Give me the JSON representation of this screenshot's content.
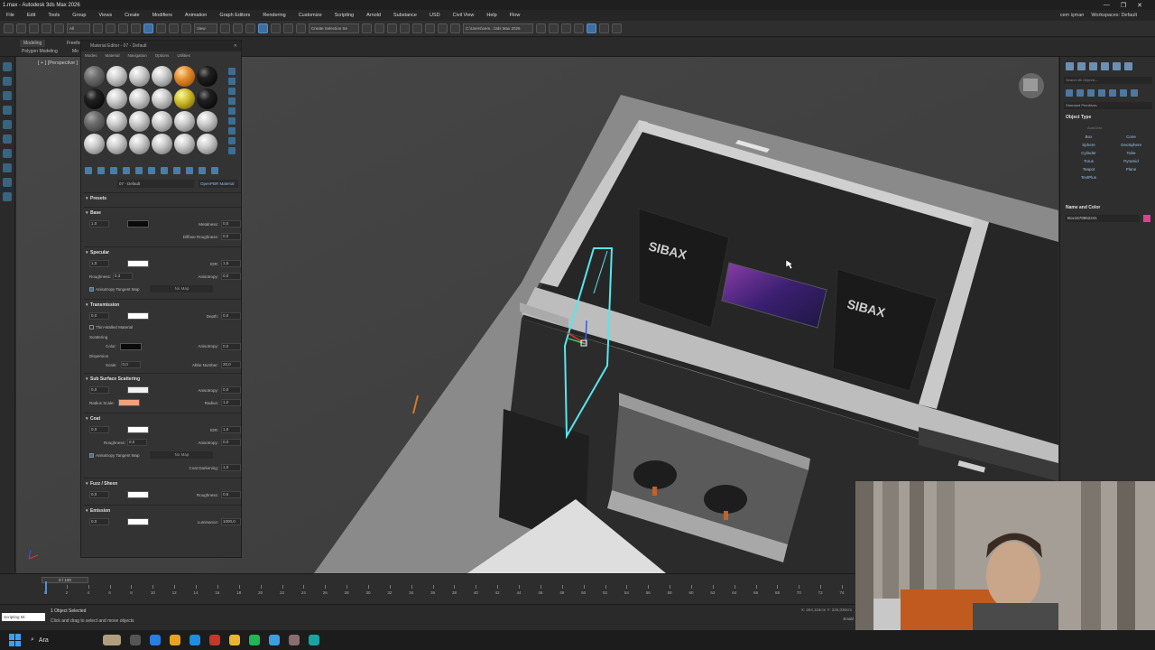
{
  "window": {
    "title": "1.max - Autodesk 3ds Max 2026",
    "controls": [
      "—",
      "❐",
      "✕"
    ]
  },
  "menu": {
    "items": [
      "File",
      "Edit",
      "Tools",
      "Group",
      "Views",
      "Create",
      "Modifiers",
      "Animation",
      "Graph Editors",
      "Rendering",
      "Customize",
      "Scripting",
      "Arnold",
      "Substance",
      "USD",
      "Civil View",
      "Help",
      "Flow"
    ],
    "user": "cem işman",
    "workspace_label": "Workspaces:",
    "workspace_value": "Default"
  },
  "toolbar": {
    "filter_dropdown": "All",
    "view_dropdown": "View",
    "selection_set": "Create Selection Se",
    "path": "C:\\Users\\cem...\\3ds Max 2026"
  },
  "ribbon": {
    "tabs": [
      "Modeling",
      "Freeform",
      "Polygon Modeling",
      "Mo"
    ]
  },
  "viewport": {
    "label": "[ + ] [Perspective ]",
    "sign_text": "SIBAX"
  },
  "material_editor": {
    "title": "Material Editor - 07 - Default",
    "menus": [
      "Modes",
      "Material",
      "Navigation",
      "Options",
      "Utilities"
    ],
    "material_name": "07 - Default",
    "material_type": "OpenPBR Material",
    "presets": "Presets",
    "base": {
      "header": "Base",
      "weight": "1,0",
      "metalness_label": "Metalness:",
      "metalness": "0,0",
      "diffuse_rough_label": "Diffuse Roughness:",
      "diffuse_rough": "0,0"
    },
    "specular": {
      "header": "Specular",
      "weight": "1,0",
      "ior_label": "IOR:",
      "ior": "1,5",
      "roughness_label": "Roughness:",
      "roughness": "0,3",
      "aniso_label": "Anisotropy:",
      "aniso": "0,0",
      "tangent_map": "Anisotropy Tangent Map",
      "no_map": "No Map"
    },
    "transmission": {
      "header": "Transmission",
      "weight": "0,0",
      "depth_label": "Depth:",
      "depth": "0,0",
      "thin_walled": "Thin-Walled Material",
      "scattering": "Scattering",
      "color_label": "Color:",
      "aniso_label": "Anisotropy:",
      "aniso": "0,0",
      "dispersion": "Dispersion",
      "scale_label": "Scale:",
      "scale": "0,0",
      "abbe_label": "Abbe Number:",
      "abbe": "20,0"
    },
    "sss": {
      "header": "Sub Surface Scattering",
      "weight": "0,0",
      "aniso_label": "Anisotropy:",
      "aniso": "0,0",
      "radius_scale_label": "Radius Scale:",
      "radius_label": "Radius:",
      "radius": "1,0"
    },
    "coat": {
      "header": "Coat",
      "weight": "0,0",
      "ior_label": "IOR:",
      "ior": "1,6",
      "roughness_label": "Roughness:",
      "roughness": "0,0",
      "aniso_label": "Anisotropy:",
      "aniso": "0,0",
      "tangent_map": "Anisotropy Tangent Map",
      "no_map": "No Map",
      "darkening_label": "Coat Darkening:",
      "darkening": "1,0"
    },
    "fuzz": {
      "header": "Fuzz / Sheen",
      "weight": "0,0",
      "roughness_label": "Roughness:",
      "roughness": "0,5"
    },
    "emission": {
      "header": "Emission",
      "weight": "0,0",
      "luminance_label": "Luminance:",
      "luminance": "1000,0"
    },
    "colors": {
      "black": "#0a0a0a",
      "white": "#ffffff",
      "light": "#f2f2f2",
      "radius_scale": "#f4a07a"
    }
  },
  "command_panel": {
    "search": "Search All Objects...",
    "category": "Standard Primitives",
    "object_type_header": "Object Type",
    "autogrid": "AutoGrid",
    "objects": [
      "Box",
      "Cone",
      "Sphere",
      "GeoSphere",
      "Cylinder",
      "Tube",
      "Torus",
      "Pyramid",
      "Teapot",
      "Plane",
      "TextPlus"
    ],
    "name_color_header": "Name and Color",
    "object_name": "Box1578862241",
    "object_color": "#d8448e"
  },
  "timeline": {
    "frame_slider": "0 / 100",
    "ticks": [
      "0",
      "2",
      "4",
      "6",
      "8",
      "10",
      "12",
      "14",
      "16",
      "18",
      "20",
      "22",
      "24",
      "26",
      "28",
      "30",
      "32",
      "34",
      "36",
      "38",
      "40",
      "42",
      "44",
      "46",
      "48",
      "50",
      "52",
      "54",
      "56",
      "58",
      "60",
      "62",
      "64",
      "66",
      "68",
      "70",
      "72",
      "74"
    ]
  },
  "status": {
    "script_label": "Scripting Mi",
    "selected": "1 Object Selected",
    "prompt": "Click and drag to select and move objects",
    "coords": "X: 264,116cm  Y: 325,036cm",
    "enable": "Enabl"
  },
  "taskbar": {
    "search": "Ara"
  }
}
